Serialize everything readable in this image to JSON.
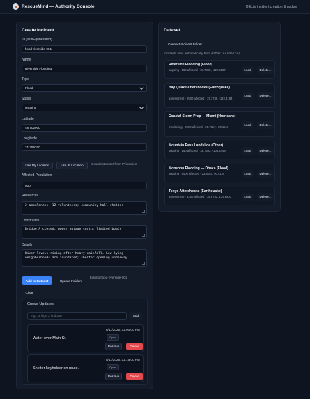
{
  "app": {
    "title": "RescueMind — Authority Console",
    "tagline": "Official incident creation & update"
  },
  "create": {
    "heading": "Create Incident",
    "id_label": "ID (auto-generated)",
    "id_value": "flood-riverside-001",
    "name_label": "Name",
    "name_value": "Riverside Flooding",
    "type_label": "Type",
    "type_value": "Flood",
    "status_label": "Status",
    "status_value": "ongoing",
    "lat_label": "Latitude",
    "lat_value": "48.702900",
    "lon_label": "Longitude",
    "lon_value": "21.255200",
    "my_location_button": "Use My Location",
    "ip_location_button": "Use IP Location",
    "location_note": "Coordinates set from IP location",
    "population_label": "Affected Population",
    "population_value": "500",
    "resources_label": "Resources",
    "resources_value": "2 ambulances; 12 volunteers; community hall shelter",
    "constraints_label": "Constraints",
    "constraints_value": "Bridge A closed; power outage south; limited boats",
    "details_label": "Details",
    "details_value": "River levels rising after heavy rainfall. Low-lying neighborhoods are inundated; shelter opening underway.",
    "add_button": "Add to Dataset",
    "update_button": "Update Incident",
    "editing_note": "Editing flood-riverside-001",
    "clear_button": "Clear"
  },
  "crowd": {
    "heading": "Crowd Updates",
    "input_placeholder": "e.g., Bridge X is down",
    "add_button": "Add",
    "updates": [
      {
        "text": "Water over Main St.",
        "timestamp": "8/11/2025, 12:00:00 PM",
        "status": "Open",
        "resolve": "Resolve",
        "delete": "Delete"
      },
      {
        "text": "Shelter keyholder en route.",
        "timestamp": "8/11/2025, 12:15:00 PM",
        "status": "Open",
        "resolve": "Resolve",
        "delete": "Delete"
      }
    ]
  },
  "dataset": {
    "heading": "Dataset",
    "connect_button": "Connect Incident Folder",
    "note_prefix": "Incidents load automatically from ",
    "note_path": "data/incidents/",
    "note_suffix": ".",
    "load_label": "Load",
    "delete_label": "Delete...",
    "items": [
      {
        "title": "Riverside Flooding (Flood)",
        "meta": "ongoing · 500 affected · 37.7805, -122.4207"
      },
      {
        "title": "Bay Quake Aftershocks (Earthquake)",
        "meta": "assessment · 2500 affected · 37.7749, -122.4194"
      },
      {
        "title": "Coastal Storm Prep — Miami (Hurricane)",
        "meta": "monitoring · 3200 affected · 25.7617, -80.1918"
      },
      {
        "title": "Mountain Pass Landslide (Other)",
        "meta": "ongoing · 150 affected · 39.7392, -105.2449"
      },
      {
        "title": "Monsoon Flooding — Dhaka (Flood)",
        "meta": "ongoing · 5400 affected · 23.8103, 90.4125"
      },
      {
        "title": "Tokyo Aftershocks (Earthquake)",
        "meta": "assessment · 4200 affected · 35.6762, 139.6503"
      }
    ]
  },
  "colors": {
    "background": "#0e1420",
    "panel": "#141c2a",
    "primary": "#3b82f6",
    "danger": "#e5484d"
  }
}
